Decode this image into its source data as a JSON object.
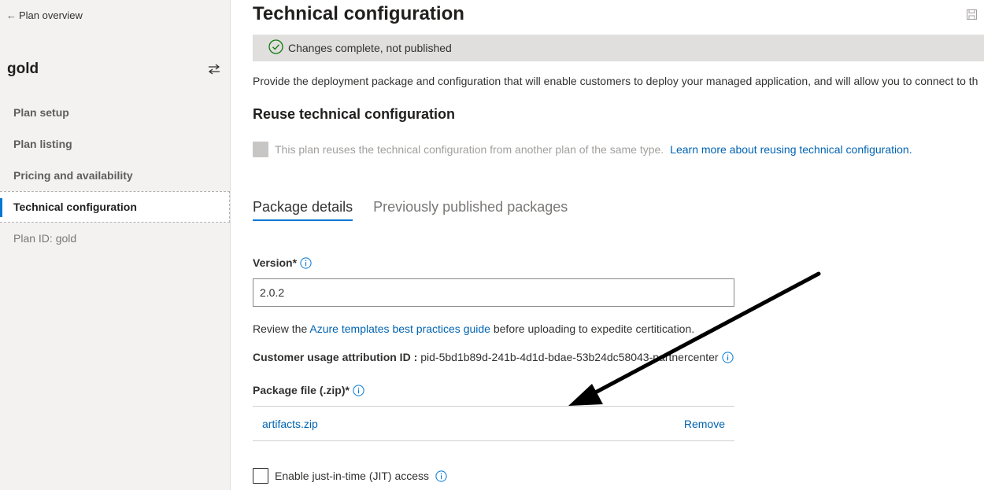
{
  "sidebar": {
    "back_label": "Plan overview",
    "plan_name": "gold",
    "items": [
      {
        "label": "Plan setup"
      },
      {
        "label": "Plan listing"
      },
      {
        "label": "Pricing and availability"
      },
      {
        "label": "Technical configuration",
        "active": true
      },
      {
        "label": "Plan ID: gold"
      }
    ]
  },
  "main": {
    "title": "Technical configuration",
    "status": "Changes complete, not published",
    "intro": "Provide the deployment package and configuration that will enable customers to deploy your managed application, and will allow you to connect to th",
    "reuse": {
      "title": "Reuse technical configuration",
      "text": "This plan reuses the technical configuration from another plan of the same type.",
      "link": "Learn more about reusing technical configuration."
    },
    "tabs": [
      {
        "label": "Package details",
        "active": true
      },
      {
        "label": "Previously published packages",
        "active": false
      }
    ],
    "version": {
      "label": "Version*",
      "value": "2.0.2"
    },
    "review": {
      "prefix": "Review the",
      "link": "Azure templates best practices guide",
      "suffix": "before uploading to expedite certitication."
    },
    "attribution": {
      "label": "Customer usage attribution ID :",
      "value": "pid-5bd1b89d-241b-4d1d-bdae-53b24dc58043-partnercenter"
    },
    "package": {
      "label": "Package file (.zip)*",
      "file_name": "artifacts.zip",
      "remove_label": "Remove"
    },
    "jit": {
      "label": "Enable just-in-time (JIT) access",
      "checked": false
    }
  },
  "colors": {
    "accent": "#0078d4",
    "link": "#0063b1",
    "success": "#107c10",
    "sidebar_bg": "#f3f2f1",
    "status_bg": "#e1dfdd"
  },
  "icons": [
    "back-arrow-icon",
    "switch-plan-icon",
    "save-icon",
    "check-circle-icon",
    "info-icon"
  ]
}
